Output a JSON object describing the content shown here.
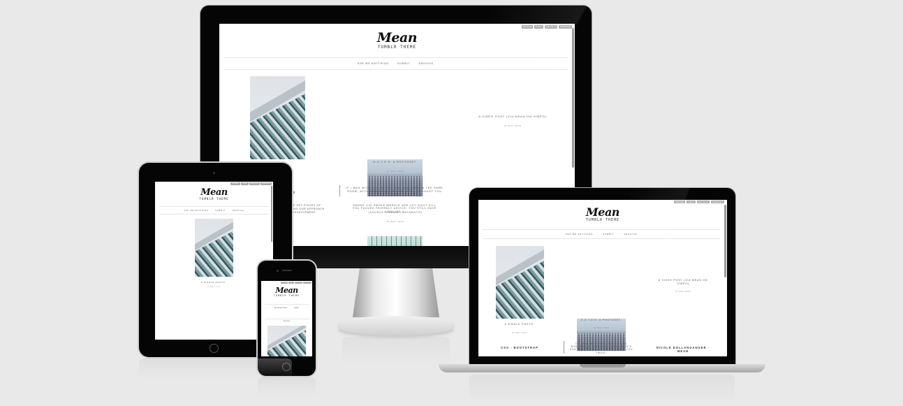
{
  "theme": {
    "logo_script": "Mean",
    "logo_sub": "TUMBLR THEME"
  },
  "tumblr_controls": [
    "Message",
    "Follow",
    "Edit theme",
    "Dashboard"
  ],
  "nav": [
    "ASK ME ANYTHING",
    "SUBMIT",
    "ARCHIVE"
  ],
  "posts": {
    "single_photo": {
      "caption": "A SINGLE PHOTO.",
      "date": "31 MAY 2016"
    },
    "photoset": {
      "caption": "S.O.T.E.E: A PHOTOSET.",
      "date": "31 MAY 2016"
    },
    "video": {
      "caption": "A VIDEO POST (VIA MEAN ON VIMEO)",
      "date": "31 MAY 2016"
    },
    "text_left_title": "CSS - BOOTSTRAP",
    "text_left_fragment_title": "AP",
    "text_left_fragment_body": "THE KEY PIECES OF\nIDING OUR APPROACH\nE DEVELOPMENT",
    "quote": "IF I WAS WITH YOU, HITLER AND BINLADEN IN THE SAME ROOM, WITH A GUN AND TWO BULLETS, I'D SHOOT YOU TWICE.",
    "quote_laptop": "IF I WAS WITH YOU, HITLER AND BINLADEN IN THE SAME ROOM, WITH A GUN AND TWO BULLETS, I'D SHOOT YOU TWICE.",
    "link_text": "SMOKE CIG SMOKE WEEDLE ARE LOT GUILT KILL YOU FUCKED FRIENDLY ADVICE, YOU STILL HAVE A BULLET :)",
    "link_source": "(SOURCE: KAKASHI.HATAMOTO)",
    "quote_date": "31 MAY 2016",
    "right_title": "NICOLE DOLLANGANGER - MEAN"
  }
}
